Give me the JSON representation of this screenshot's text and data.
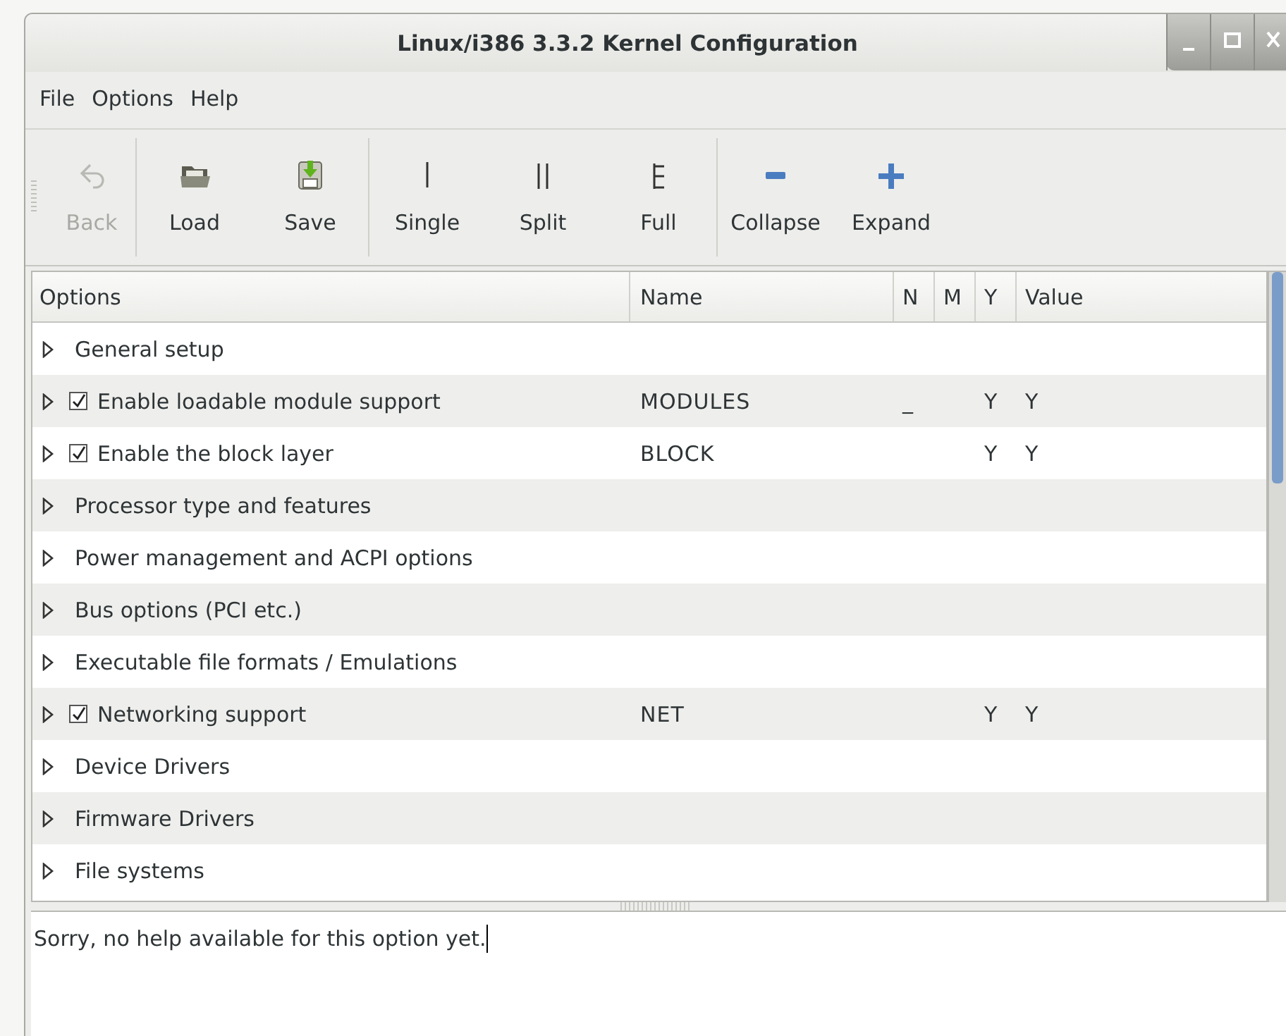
{
  "window": {
    "title": "Linux/i386 3.3.2 Kernel Configuration"
  },
  "menu": [
    "File",
    "Options",
    "Help"
  ],
  "toolbar": [
    {
      "label": "Back",
      "kind": "back",
      "disabled": true
    },
    {
      "label": "Load",
      "kind": "load",
      "disabled": false
    },
    {
      "label": "Save",
      "kind": "save",
      "disabled": false
    },
    {
      "label": "Single",
      "kind": "single",
      "disabled": false
    },
    {
      "label": "Split",
      "kind": "split",
      "disabled": false
    },
    {
      "label": "Full",
      "kind": "full",
      "disabled": false
    },
    {
      "label": "Collapse",
      "kind": "collapse",
      "disabled": false
    },
    {
      "label": "Expand",
      "kind": "expand",
      "disabled": false
    }
  ],
  "table": {
    "columns": [
      "Options",
      "Name",
      "N",
      "M",
      "Y",
      "Value"
    ],
    "rows": [
      {
        "option": "General setup",
        "expanded": false
      },
      {
        "option": "Enable loadable module support",
        "checked": true,
        "name": "MODULES",
        "n": "_",
        "y": "Y",
        "value": "Y",
        "expanded": false
      },
      {
        "option": "Enable the block layer",
        "checked": true,
        "name": "BLOCK",
        "y": "Y",
        "value": "Y",
        "expanded": false
      },
      {
        "option": "Processor type and features",
        "expanded": false
      },
      {
        "option": "Power management and ACPI options",
        "expanded": false
      },
      {
        "option": "Bus options (PCI etc.)",
        "expanded": false
      },
      {
        "option": "Executable file formats / Emulations",
        "expanded": false
      },
      {
        "option": "Networking support",
        "checked": true,
        "name": "NET",
        "y": "Y",
        "value": "Y",
        "expanded": false
      },
      {
        "option": "Device Drivers",
        "expanded": false
      },
      {
        "option": "Firmware Drivers",
        "expanded": false
      },
      {
        "option": "File systems",
        "expanded": false
      }
    ]
  },
  "help_text": "Sorry, no help available for this option yet."
}
